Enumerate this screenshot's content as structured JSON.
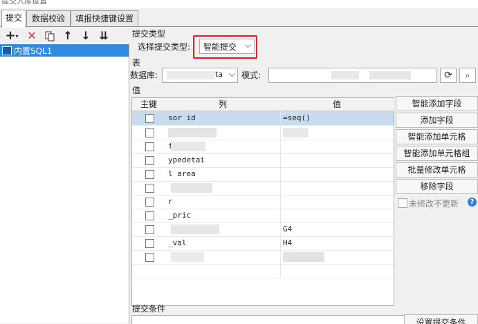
{
  "window": {
    "title": "提交入库设置"
  },
  "tabs": [
    {
      "label": "提交",
      "active": true
    },
    {
      "label": "数据校验",
      "active": false
    },
    {
      "label": "填报快捷键设置",
      "active": false
    }
  ],
  "toolbar": {
    "add_icon": "plus-dropdown-icon",
    "delete_icon": "red-x-icon",
    "copy_icon": "copy-icon",
    "up_icon": "arrow-up-icon",
    "down_icon": "arrow-down-icon",
    "sort_icon": "sort-down-icon"
  },
  "tree": {
    "items": [
      {
        "label": "内置SQL1"
      }
    ]
  },
  "submit_type": {
    "section_label": "提交类型",
    "label": "选择提交类型:",
    "value": "智能提交"
  },
  "table_section": {
    "section_label": "表",
    "db_label": "数据库:",
    "db_value_fragment": "ta",
    "schema_label": "模式:"
  },
  "values_section": {
    "section_label": "值",
    "columns": {
      "key": "主键",
      "column": "列",
      "value": "值"
    },
    "rows": [
      {
        "column": "sor   id",
        "value": "=seq()",
        "selected": true
      },
      {
        "column": "",
        "value": "",
        "selected": false
      },
      {
        "column": "f",
        "value": "",
        "selected": false
      },
      {
        "column": "   ypedetai",
        "value": "",
        "selected": false
      },
      {
        "column": "l   area",
        "value": "",
        "selected": false
      },
      {
        "column": "",
        "value": "",
        "selected": false
      },
      {
        "column": "       r",
        "value": "",
        "selected": false
      },
      {
        "column": "        _pric",
        "value": "",
        "selected": false
      },
      {
        "column": "",
        "value": "G4",
        "selected": false
      },
      {
        "column": "   _val",
        "value": "H4",
        "selected": false
      },
      {
        "column": "",
        "value": "          e",
        "selected": false
      },
      {
        "column": "",
        "value": "",
        "selected": false
      }
    ]
  },
  "buttons": {
    "smart_add_field": "智能添加字段",
    "add_field": "添加字段",
    "smart_add_cell": "智能添加单元格",
    "smart_add_cell_group": "智能添加单元格组",
    "batch_modify_cell": "批量修改单元格",
    "remove_field": "移除字段"
  },
  "no_update_unmodified": {
    "label": "未修改不更新",
    "checked": false
  },
  "conditions": {
    "section_label": "提交条件",
    "button": "设置提交条件"
  }
}
